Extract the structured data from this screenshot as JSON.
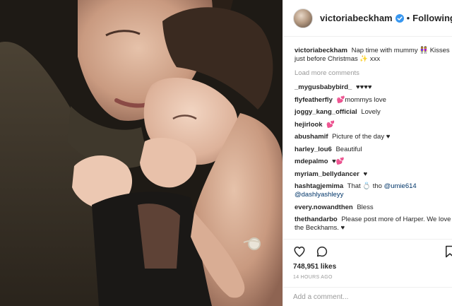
{
  "header": {
    "username": "victoriabeckham",
    "separator": "•",
    "follow_label": "Following",
    "verified_color": "#3897f0"
  },
  "caption": {
    "user": "victoriabeckham",
    "text": "Nap time with mummy 👭 Kisses just before Christmas ✨ xxx"
  },
  "load_more": "Load more comments",
  "comments": [
    {
      "user": "_mygusbabybird_",
      "text": "♥♥♥♥"
    },
    {
      "user": "flyfeatherfly",
      "text": "💕mommys love"
    },
    {
      "user": "joggy_kang_official",
      "text": "Lovely"
    },
    {
      "user": "hejirlook",
      "text": "💕"
    },
    {
      "user": "abushamif",
      "text": "Picture of the day ♥"
    },
    {
      "user": "harley_lou6",
      "text": "Beautiful"
    },
    {
      "user": "mdepalmo",
      "text": "♥💕"
    },
    {
      "user": "myriam_bellydancer",
      "text": "♥"
    },
    {
      "user": "hashtagjemima",
      "text": "That 💍 tho",
      "mentions": "@umie614 @dashlyashleyy"
    },
    {
      "user": "every.nowandthen",
      "text": "Bless"
    },
    {
      "user": "thethandarbo",
      "text": "Please post more of Harper. We love the Beckhams. ♥"
    }
  ],
  "likes": "748,951 likes",
  "time": "14 HOURS AGO",
  "add_comment_placeholder": "Add a comment...",
  "icons": {
    "like": "heart-icon",
    "comment": "comment-bubble-icon",
    "save": "bookmark-icon",
    "verified": "verified-badge-icon"
  },
  "colors": {
    "text": "#262626",
    "muted": "#999999",
    "mention": "#003569",
    "border": "#efefef"
  }
}
